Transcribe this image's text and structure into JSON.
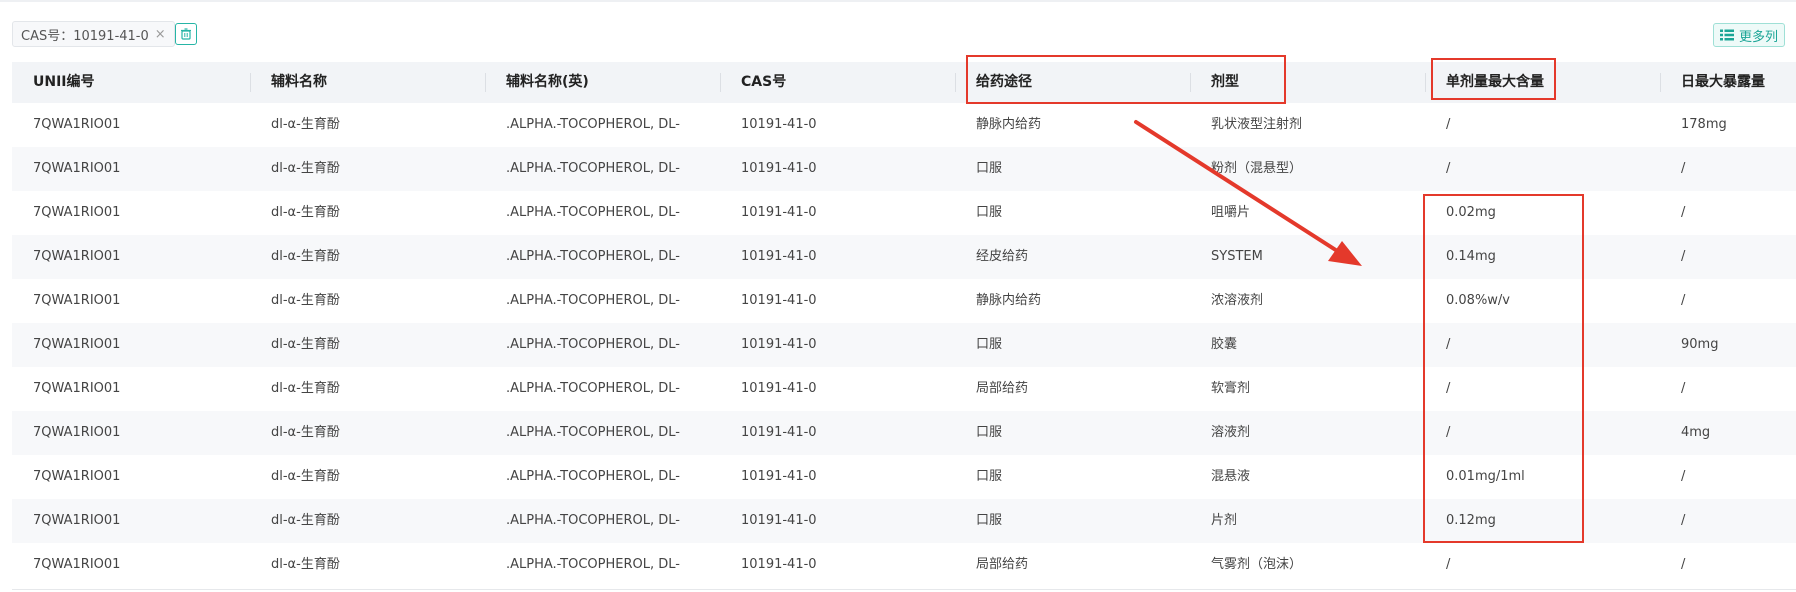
{
  "filter": {
    "tag_label": "CAS号：10191-41-0",
    "close_glyph": "×"
  },
  "toolbar": {
    "clear_icon": "trash-icon",
    "more_columns_label": "更多列",
    "more_columns_icon": "list-icon"
  },
  "table": {
    "columns": [
      "UNII编号",
      "辅料名称",
      "辅料名称(英)",
      "CAS号",
      "给药途径",
      "剂型",
      "单剂量最大含量",
      "日最大暴露量"
    ],
    "rows": [
      [
        "7QWA1RIO01",
        "dl-α-生育酚",
        ".ALPHA.-TOCOPHEROL, DL-",
        "10191-41-0",
        "静脉内给药",
        "乳状液型注射剂",
        "/",
        "178mg"
      ],
      [
        "7QWA1RIO01",
        "dl-α-生育酚",
        ".ALPHA.-TOCOPHEROL, DL-",
        "10191-41-0",
        "口服",
        "粉剂（混悬型）",
        "/",
        "/"
      ],
      [
        "7QWA1RIO01",
        "dl-α-生育酚",
        ".ALPHA.-TOCOPHEROL, DL-",
        "10191-41-0",
        "口服",
        "咀嚼片",
        "0.02mg",
        "/"
      ],
      [
        "7QWA1RIO01",
        "dl-α-生育酚",
        ".ALPHA.-TOCOPHEROL, DL-",
        "10191-41-0",
        "经皮给药",
        "SYSTEM",
        "0.14mg",
        "/"
      ],
      [
        "7QWA1RIO01",
        "dl-α-生育酚",
        ".ALPHA.-TOCOPHEROL, DL-",
        "10191-41-0",
        "静脉内给药",
        "浓溶液剂",
        "0.08%w/v",
        "/"
      ],
      [
        "7QWA1RIO01",
        "dl-α-生育酚",
        ".ALPHA.-TOCOPHEROL, DL-",
        "10191-41-0",
        "口服",
        "胶囊",
        "/",
        "90mg"
      ],
      [
        "7QWA1RIO01",
        "dl-α-生育酚",
        ".ALPHA.-TOCOPHEROL, DL-",
        "10191-41-0",
        "局部给药",
        "软膏剂",
        "/",
        "/"
      ],
      [
        "7QWA1RIO01",
        "dl-α-生育酚",
        ".ALPHA.-TOCOPHEROL, DL-",
        "10191-41-0",
        "口服",
        "溶液剂",
        "/",
        "4mg"
      ],
      [
        "7QWA1RIO01",
        "dl-α-生育酚",
        ".ALPHA.-TOCOPHEROL, DL-",
        "10191-41-0",
        "口服",
        "混悬液",
        "0.01mg/1ml",
        "/"
      ],
      [
        "7QWA1RIO01",
        "dl-α-生育酚",
        ".ALPHA.-TOCOPHEROL, DL-",
        "10191-41-0",
        "口服",
        "片剂",
        "0.12mg",
        "/"
      ],
      [
        "7QWA1RIO01",
        "dl-α-生育酚",
        ".ALPHA.-TOCOPHEROL, DL-",
        "10191-41-0",
        "局部给药",
        "气雾剂（泡沫）",
        "/",
        "/"
      ]
    ]
  },
  "colors": {
    "accent": "#26b5a6",
    "annotation": "#e4392b",
    "header_bg": "#f2f4f7",
    "stripe_bg": "#f7f8fa"
  }
}
